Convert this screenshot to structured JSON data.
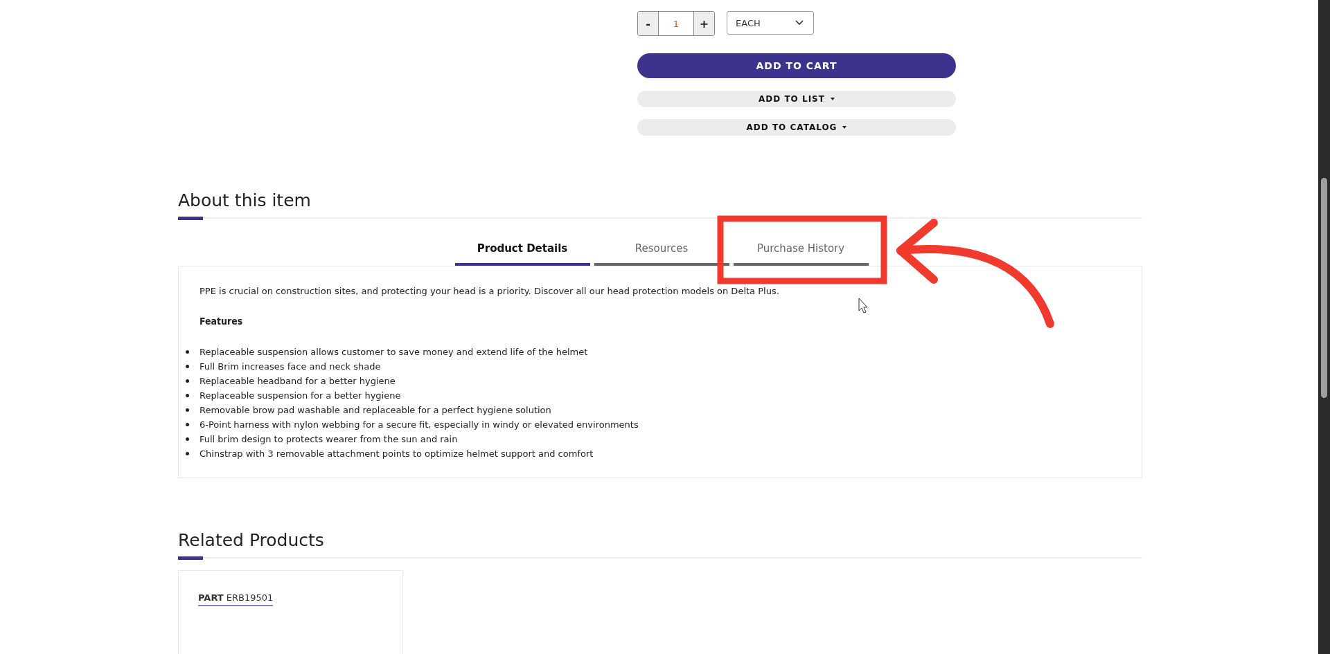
{
  "quantity": {
    "decrement": "-",
    "value": "1",
    "increment": "+"
  },
  "unit": {
    "value": "EACH"
  },
  "actions": [
    {
      "label": "ADD TO CART",
      "kind": "primary"
    },
    {
      "label": "ADD TO LIST",
      "kind": "dropdown"
    },
    {
      "label": "ADD TO CATALOG",
      "kind": "dropdown"
    }
  ],
  "about": {
    "title": "About this item",
    "tabs": [
      {
        "label": "Product Details",
        "selected": true
      },
      {
        "label": "Resources",
        "selected": false
      },
      {
        "label": "Purchase History",
        "selected": false
      }
    ],
    "description": "PPE is crucial on construction sites, and protecting your head is a priority. Discover all our head protection models on Delta Plus.",
    "features_heading": "Features",
    "features": [
      "Replaceable suspension allows customer to save money and extend life of the helmet",
      "Full Brim increases face and neck shade",
      "Replaceable headband for a better hygiene",
      "Replaceable suspension for a better hygiene",
      "Removable brow pad washable and replaceable for a perfect hygiene solution",
      "6-Point harness with nylon webbing for a secure fit, especially in windy or elevated environments",
      "Full brim design to protects wearer from the sun and rain",
      "Chinstrap with 3 removable attachment points to optimize helmet support and comfort"
    ]
  },
  "related": {
    "title": "Related Products",
    "products": [
      {
        "part": "**PART** ERB19501"
      }
    ]
  }
}
